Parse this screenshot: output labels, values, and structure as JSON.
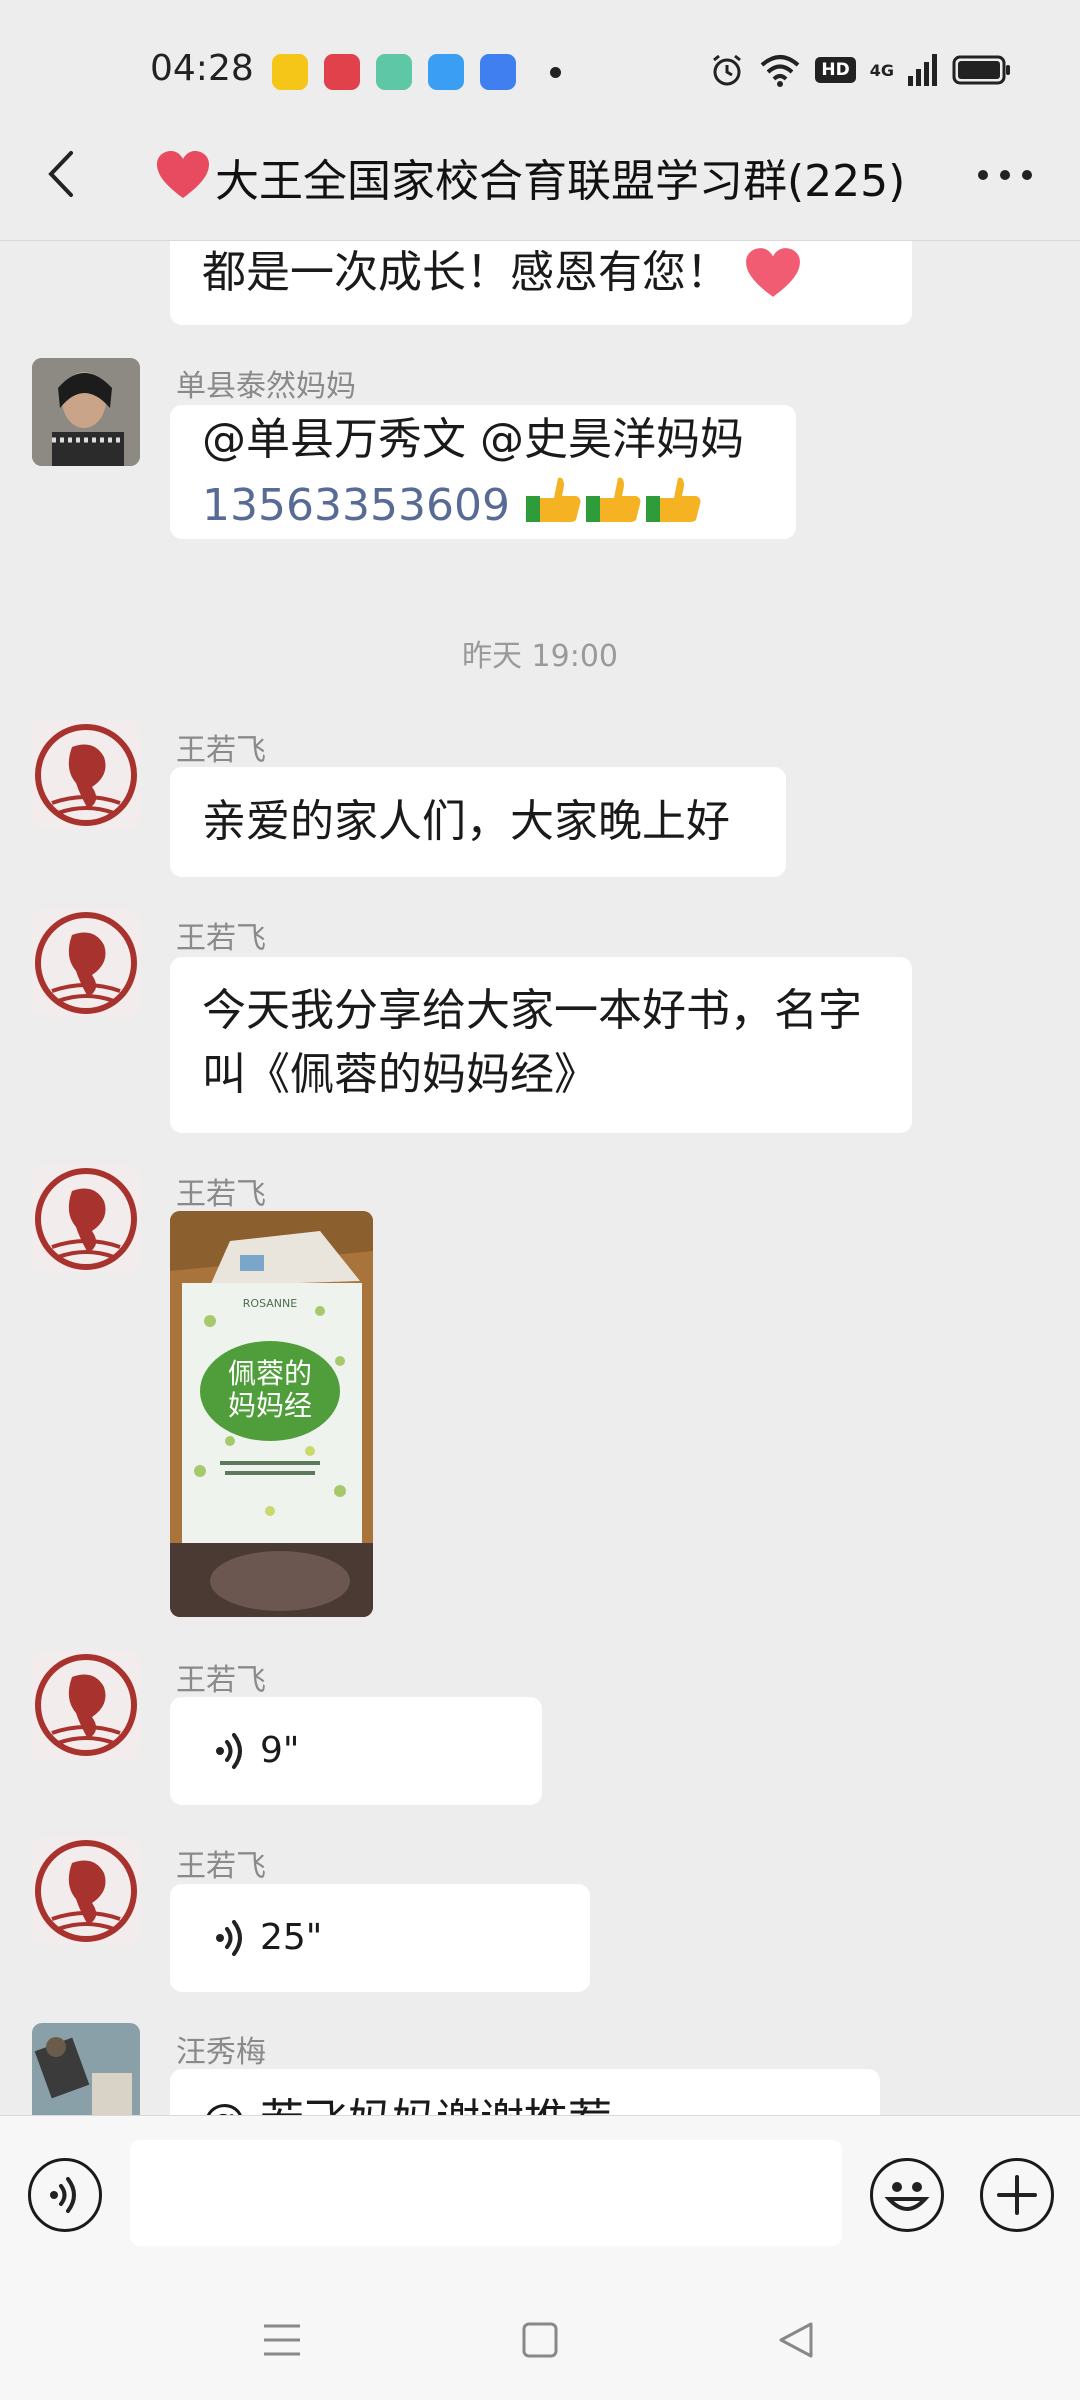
{
  "status_bar": {
    "time": "04:28",
    "app_icons": [
      {
        "name": "notes-app-icon",
        "color": "#f5c518"
      },
      {
        "name": "taobao-app-icon",
        "color": "#e0414a"
      },
      {
        "name": "app-green-icon",
        "color": "#5dc7a6"
      },
      {
        "name": "qq-browser-icon",
        "color": "#3a9ef5"
      },
      {
        "name": "app-blue-icon",
        "color": "#3f7ff0"
      }
    ],
    "hd_label": "HD",
    "network_label": "4G"
  },
  "header": {
    "title": "大王全国家校合育联盟学习群(225)"
  },
  "messages": {
    "m0": {
      "text": "都是一次成长！感恩有您！"
    },
    "m1": {
      "sender": "单县泰然妈妈",
      "text_line1": "@单县万秀文 @史昊洋妈妈",
      "phone": "13563353609"
    },
    "time_separator": "昨天 19:00",
    "m2": {
      "sender": "王若飞",
      "text": "亲爱的家人们，大家晚上好"
    },
    "m3": {
      "sender": "王若飞",
      "text_line1": "今天我分享给大家一本好书，名字",
      "text_line2": "叫《佩蓉的妈妈经》"
    },
    "m4": {
      "sender": "王若飞",
      "book_title_line1": "佩蓉的",
      "book_title_line2": "妈妈经",
      "book_brand": "ROSANNE"
    },
    "m5": {
      "sender": "王若飞",
      "duration": "9\""
    },
    "m6": {
      "sender": "王若飞",
      "duration": "25\""
    },
    "m7": {
      "sender": "汪秀梅",
      "text_partial": "@ 若飞妈妈谢谢推荐"
    }
  },
  "colors": {
    "background": "#ededed",
    "bubble": "#ffffff",
    "link": "#576b95",
    "avatar_red": "#a8322d"
  }
}
